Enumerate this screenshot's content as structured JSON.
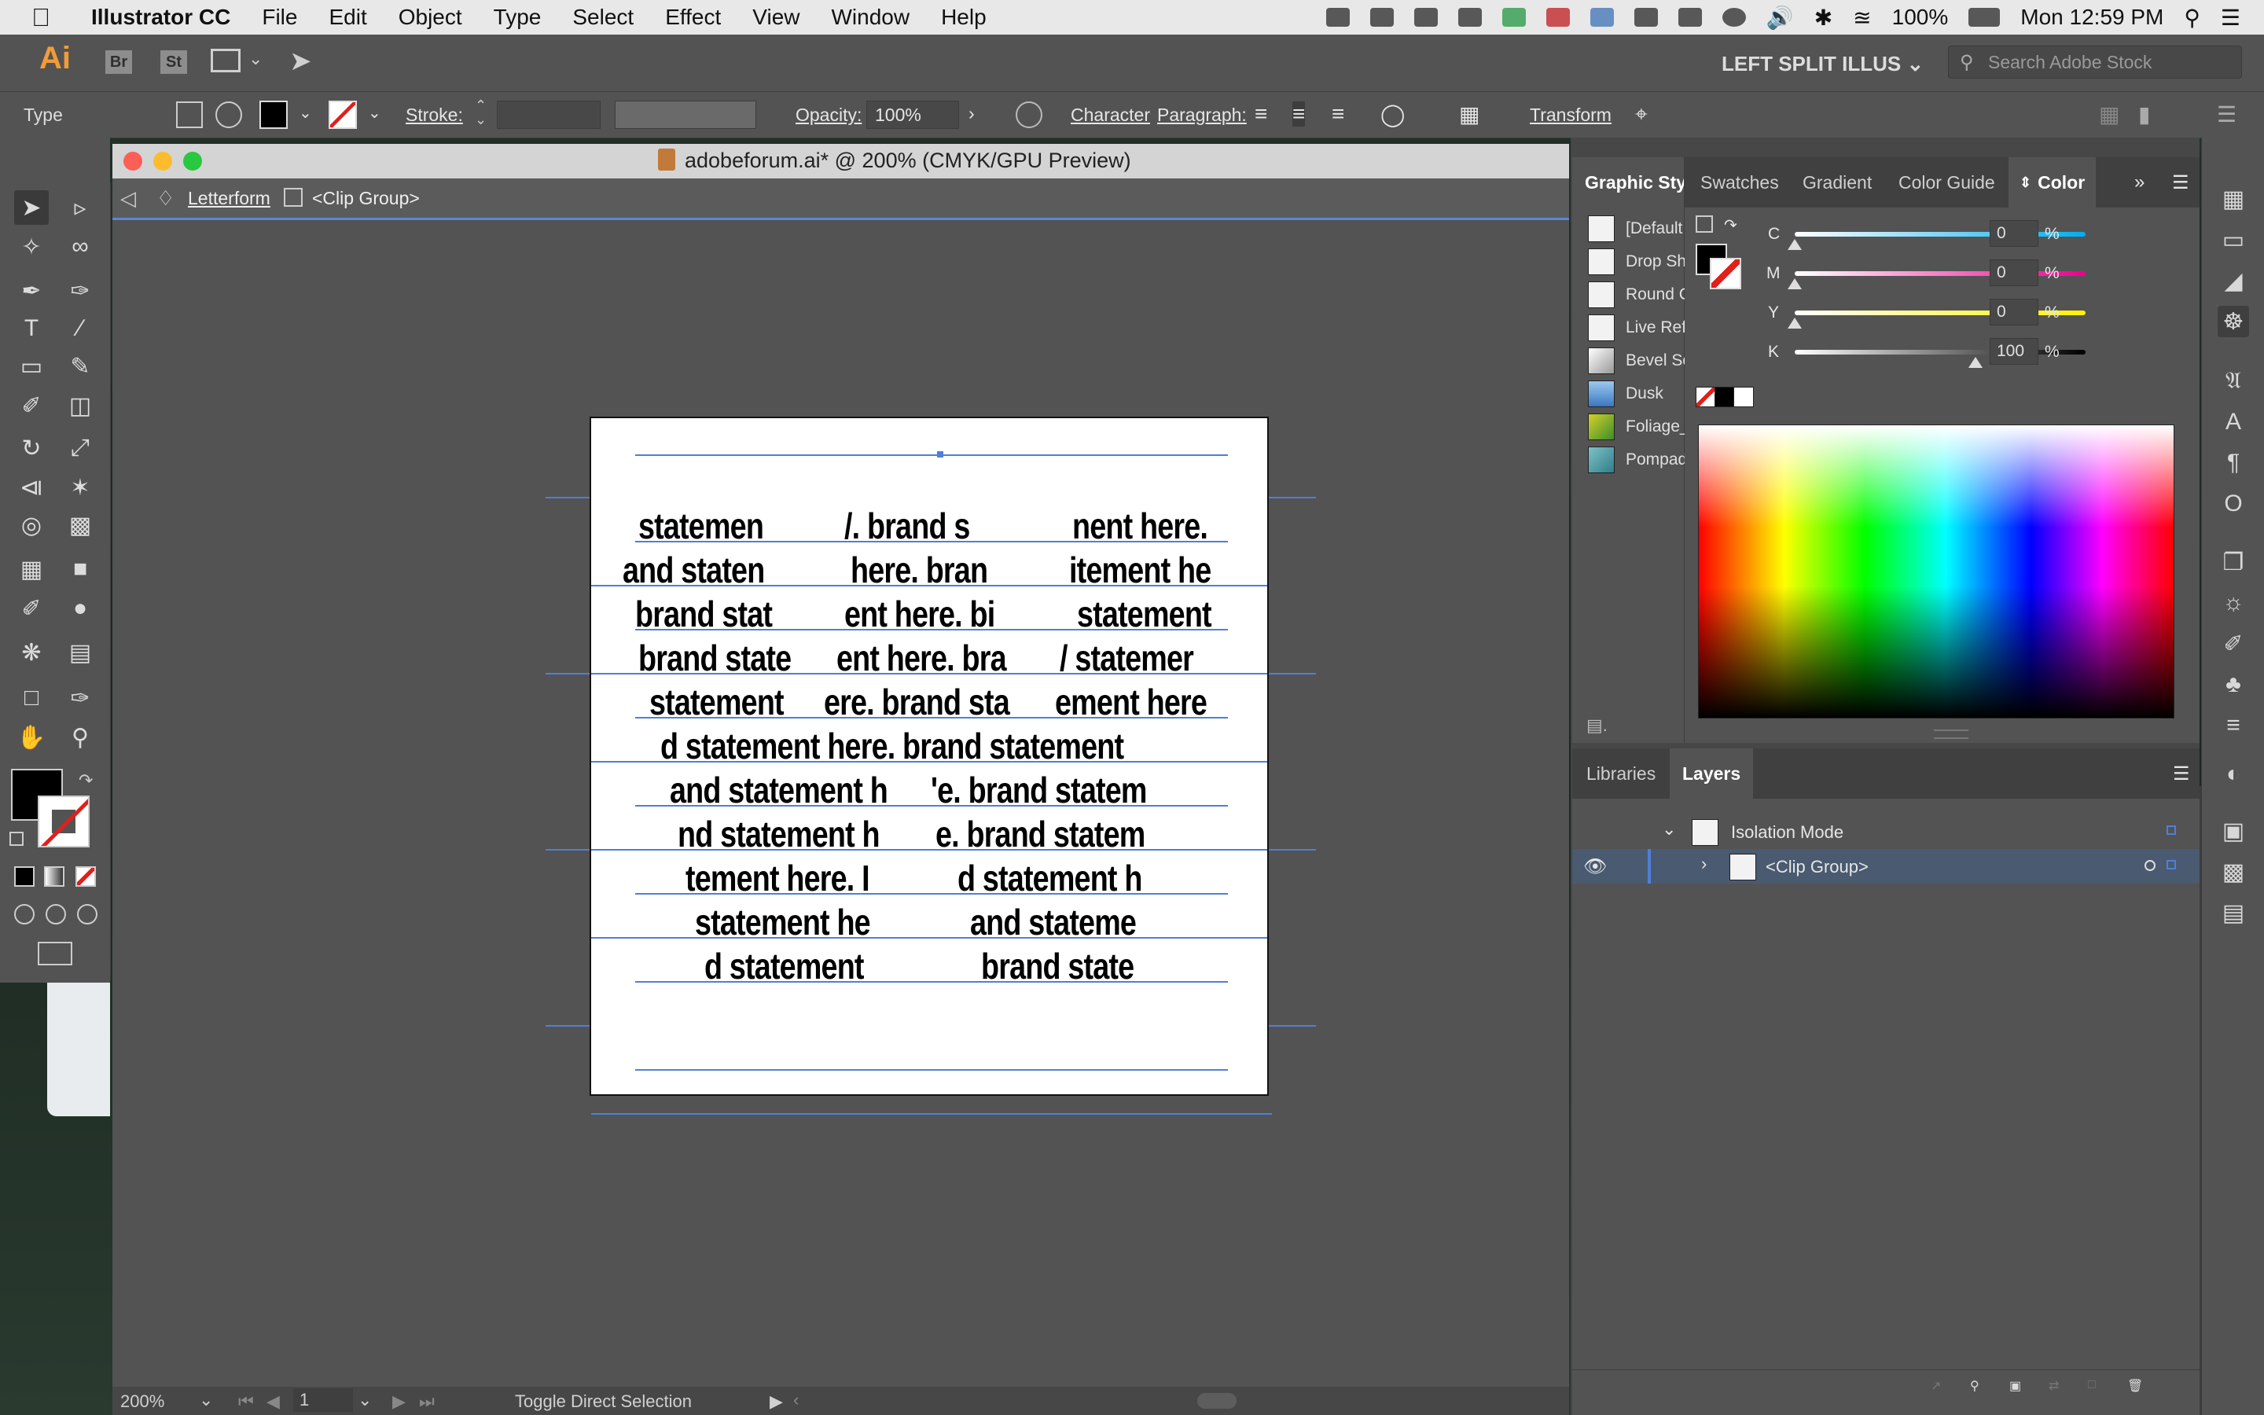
{
  "menubar": {
    "app_name": "Illustrator CC",
    "items": [
      "File",
      "Edit",
      "Object",
      "Type",
      "Select",
      "Effect",
      "View",
      "Window",
      "Help"
    ],
    "battery": "100%",
    "clock": "Mon 12:59 PM"
  },
  "appbar": {
    "logo": "Ai",
    "bridge": "Br",
    "stock_app": "St",
    "workspace": "LEFT SPLIT ILLUS",
    "search_placeholder": "Search Adobe Stock"
  },
  "controlbar": {
    "selection_type": "Type",
    "stroke_label": "Stroke:",
    "opacity_label": "Opacity:",
    "opacity_value": "100%",
    "character": "Character",
    "paragraph": "Paragraph:",
    "transform": "Transform"
  },
  "document": {
    "title": "adobeforum.ai* @ 200% (CMYK/GPU Preview)",
    "breadcrumb_layer": "Letterform",
    "breadcrumb_group": "<Clip Group>"
  },
  "artwork_lines": [
    [
      "statemen",
      "/. brand s",
      "nent here."
    ],
    [
      "and staten",
      "here. bran",
      "itement he"
    ],
    [
      "brand stat",
      "ent here. bi",
      "statement"
    ],
    [
      "brand state",
      "ent here. bra",
      "/ statemer"
    ],
    [
      "statement",
      "ere. brand sta",
      "ement here"
    ],
    [
      "d statement here. brand statement",
      "",
      ""
    ],
    [
      "and statement h",
      "'e. brand statem",
      ""
    ],
    [
      "nd statement h",
      "e. brand statem",
      ""
    ],
    [
      "tement here. I",
      "d statement h",
      ""
    ],
    [
      "statement he",
      "and stateme",
      ""
    ],
    [
      "d statement",
      "brand state",
      ""
    ]
  ],
  "statusbar": {
    "zoom": "200%",
    "artboard_num": "1",
    "status_text": "Toggle Direct Selection"
  },
  "graphic_styles": {
    "title": "Graphic Style",
    "items": [
      "[Default",
      "Drop Sh",
      "Round C",
      "Live Refl",
      "Bevel So",
      "Dusk",
      "Foliage_",
      "Pompad"
    ]
  },
  "color_panel": {
    "tabs": [
      "Swatches",
      "Gradient",
      "Color Guide",
      "Color"
    ],
    "channels": [
      {
        "label": "C",
        "value": "0",
        "fraction": 0.0,
        "color": "#00aeef"
      },
      {
        "label": "M",
        "value": "0",
        "fraction": 0.0,
        "color": "#ec008c"
      },
      {
        "label": "Y",
        "value": "0",
        "fraction": 0.0,
        "color": "#fff200"
      },
      {
        "label": "K",
        "value": "100",
        "fraction": 1.0,
        "color": "#000000"
      }
    ],
    "percent": "%"
  },
  "layers_panel": {
    "tabs": [
      "Libraries",
      "Layers"
    ],
    "rows": [
      {
        "name": "Isolation Mode"
      },
      {
        "name": "<Clip Group>"
      }
    ]
  },
  "colors": {
    "accent_blue": "#4f7fd6",
    "panel_bg": "#535353"
  }
}
